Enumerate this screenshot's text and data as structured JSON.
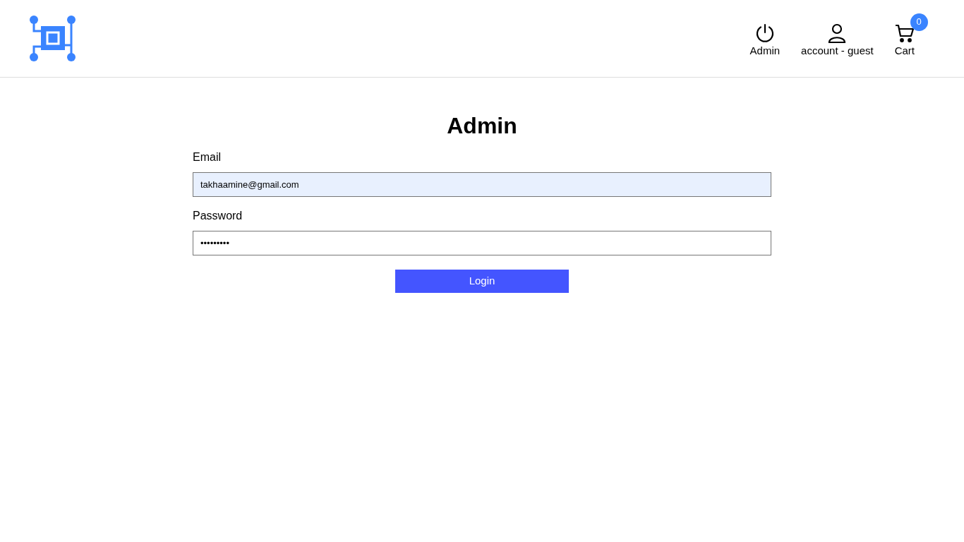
{
  "header": {
    "nav": [
      {
        "kind": "power",
        "label": "Admin"
      },
      {
        "kind": "user",
        "label": "account - guest"
      },
      {
        "kind": "cart",
        "label": "Cart",
        "badge": "0"
      }
    ]
  },
  "form": {
    "title": "Admin",
    "fields": [
      {
        "label": "Email",
        "value": "takhaamine@gmail.com",
        "autofilled": true
      },
      {
        "label": "Password",
        "value": "•••••••••",
        "autofilled": false
      }
    ],
    "button": "Login"
  }
}
